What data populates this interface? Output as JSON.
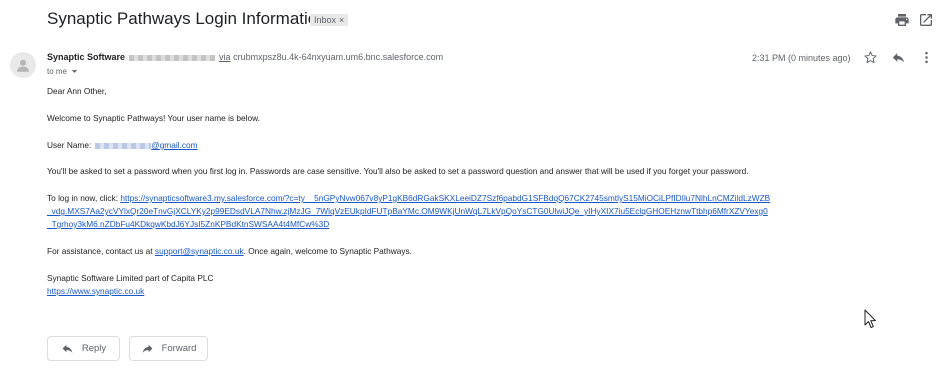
{
  "email": {
    "subject": "Synaptic Pathways Login Information",
    "label_badge": "Inbox",
    "label_close": "×",
    "sender_name": "Synaptic Software",
    "via_word": "via",
    "via_domain": "crubmxpsz8u.4k-64nxyuam.um6.bnc.salesforce.com",
    "to_line": "to me",
    "timestamp": "2:31 PM (0 minutes ago)"
  },
  "body": {
    "greeting": "Dear Ann Other,",
    "welcome": "Welcome to Synaptic Pathways! Your user name is below.",
    "username_label": "User Name:",
    "username_domain": "@gmail.com",
    "password_note": "You'll be asked to set a password when you first log in.  Passwords are case sensitive.  You'll also be asked to set a password question and answer that will be used if you forget your password.",
    "login_prefix": "To log in now, click:",
    "login_link_line1": "https://synapticsoftware3.my.salesforce.com/?c=ty__5nGPyNvw067v8yP1gKB6dRGakSKXLeeiDZ7Szf6pabdG1SFBdqQ67CK2745smtlyS15MiOCiLPfIDIlu7NlhLnCMZildLzWZB",
    "login_link_line2": "_vdg.MXS7Aa2ycVYlxQr20eTnvGjXCLYKy2p99EDsdVLA7Nhw.zjMzJG_7WlqVzEUkpIdFUTpBaYMc.OM9WKjUnWqL7LkVpQoYsCTG0UlwiJQe_yIHyXIX7iu5EclqGHOEHznwTtbhp6MfrXZVYexg0",
    "login_link_line3": "_Tgrhoy3kM6.nZDbFu4KDkqwKbdJ6YJsI5ZnKPBdKtnSWSAA4t4MfCw%3D",
    "assist_prefix": "For assistance, contact us at",
    "support_email": "support@synaptic.co.uk",
    "assist_suffix": ". Once again, welcome to Synaptic Pathways.",
    "signature_company": "Synaptic Software Limited part of Capita PLC",
    "signature_url": "https://www.synaptic.co.uk"
  },
  "actions": {
    "reply_label": "Reply",
    "forward_label": "Forward"
  },
  "icons": {
    "print": "print-icon",
    "star": "star-icon",
    "reply": "reply-icon",
    "more": "more-vertical-icon",
    "avatar": "avatar-person-icon",
    "dropdown": "chevron-down-icon",
    "forward": "forward-icon",
    "cursor": "mouse-cursor-icon"
  },
  "colors": {
    "link": "#1a57c7",
    "muted": "#5f6368",
    "badge_bg": "#e8e8e8"
  }
}
